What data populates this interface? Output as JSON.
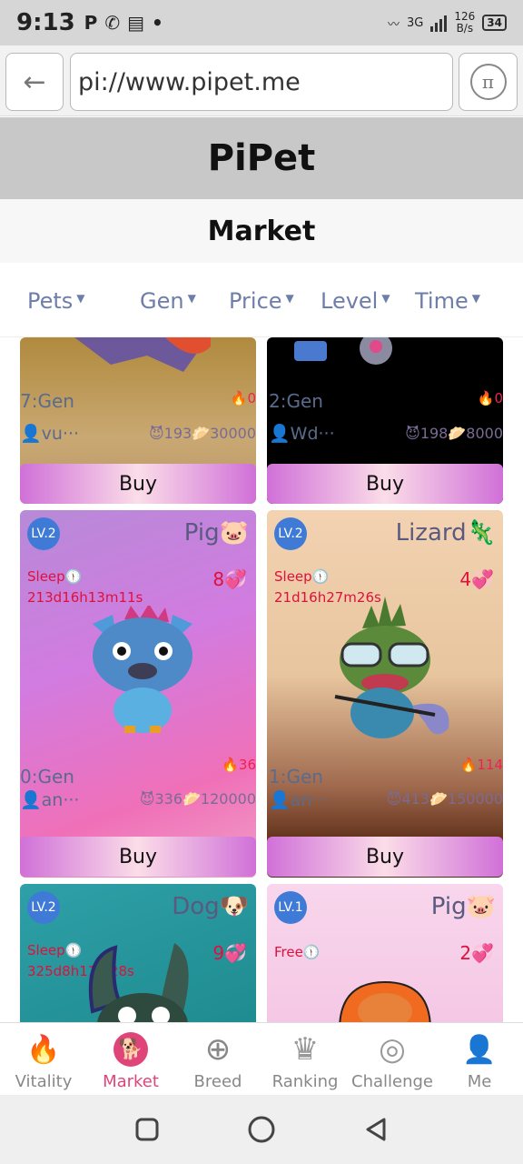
{
  "status_bar": {
    "time": "9:13",
    "icons": [
      "p-icon",
      "whatsapp-icon",
      "news-icon",
      "dot-icon"
    ],
    "network": "3G",
    "speed_value": "126",
    "speed_unit": "B/s",
    "battery": "34"
  },
  "browser": {
    "back_label": "←",
    "url": "pi://www.pipet.me",
    "pi_label": "π"
  },
  "app": {
    "title": "PiPet",
    "section": "Market"
  },
  "filters": [
    {
      "label": "Pets"
    },
    {
      "label": "Gen"
    },
    {
      "label": "Price"
    },
    {
      "label": "Level"
    },
    {
      "label": "Time"
    }
  ],
  "cards": [
    {
      "gen": "7:Gen",
      "fire": "🔥0",
      "owner": "👤vu···",
      "stats": "😈193🥟30000",
      "buy": "Buy"
    },
    {
      "gen": "2:Gen",
      "fire": "🔥0",
      "owner": "👤Wd···",
      "stats": "😈198🥟8000",
      "buy": "Buy"
    },
    {
      "level": "LV.2",
      "species": "Pig🐷",
      "status": "Sleep🕦",
      "timer": "213d16h13m11s",
      "likes": "8💞",
      "gen": "0:Gen",
      "fire": "🔥36",
      "owner": "👤an···",
      "stats": "😈336🥟120000",
      "buy": "Buy"
    },
    {
      "level": "LV.2",
      "species": "Lizard🦎",
      "status": "Sleep🕦",
      "timer": "21d16h27m26s",
      "likes": "4💞",
      "gen": "1:Gen",
      "fire": "🔥114",
      "owner": "👤an···",
      "stats": "😈413🥟150000",
      "buy": "Buy"
    },
    {
      "level": "LV.2",
      "species": "Dog🐶",
      "status": "Sleep🕦",
      "timer": "325d8h11m28s",
      "likes": "9💞"
    },
    {
      "level": "LV.1",
      "species": "Pig🐷",
      "status": "Free🕦",
      "likes": "2💞"
    }
  ],
  "tabs": [
    {
      "label": "Vitality",
      "icon": "flame-icon",
      "glyph": "🔥",
      "active": false
    },
    {
      "label": "Market",
      "icon": "dog-head-icon",
      "glyph": "🐕",
      "active": true
    },
    {
      "label": "Breed",
      "icon": "crosshair-icon",
      "glyph": "⊕",
      "active": false
    },
    {
      "label": "Ranking",
      "icon": "crown-icon",
      "glyph": "♛",
      "active": false
    },
    {
      "label": "Challenge",
      "icon": "target-icon",
      "glyph": "◎",
      "active": false
    },
    {
      "label": "Me",
      "icon": "person-icon",
      "glyph": "👤",
      "active": false
    }
  ],
  "colors": {
    "active_tab": "#e0457a",
    "inactive_tab": "#999999",
    "level_badge": "#3f7bd6",
    "accent_red": "#e0103a"
  }
}
